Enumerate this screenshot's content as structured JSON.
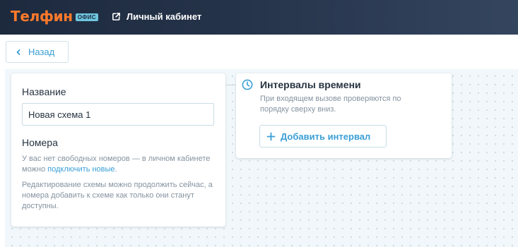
{
  "header": {
    "logo_text": "Телфин",
    "logo_badge": "ОФИС",
    "cabinet_link": "Личный кабинет"
  },
  "toolbar": {
    "back_label": "Назад"
  },
  "left_panel": {
    "name_heading": "Название",
    "name_value": "Новая схема 1",
    "numbers_heading": "Номера",
    "no_numbers_text": "У вас нет свободных номеров — в личном кабинете можно ",
    "connect_link": "подключить новые",
    "connect_link_suffix": ".",
    "edit_note": "Редактирование схемы можно продолжить сейчас, а номера добавить к схеме как только они станут доступны."
  },
  "intervals_panel": {
    "title": "Интервалы времени",
    "description": "При входящем вызове проверяются по порядку сверху вниз.",
    "add_label": "Добавить интервал"
  },
  "colors": {
    "brand_orange": "#ff7a2b",
    "accent_blue": "#3a9fd6",
    "header_dark": "#1d2a3e"
  },
  "icons": {
    "external": "external-link-icon",
    "back": "chevron-left-icon",
    "clock": "clock-icon",
    "plus": "plus-icon"
  }
}
